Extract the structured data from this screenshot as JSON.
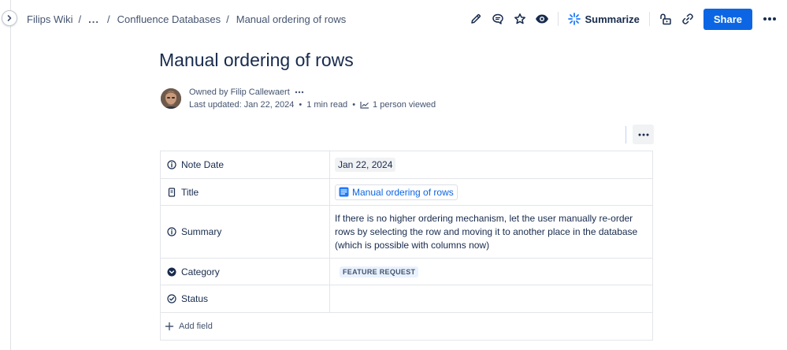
{
  "breadcrumb": {
    "items": [
      "Filips Wiki",
      "...",
      "Confluence Databases",
      "Manual ordering of rows"
    ],
    "separator": "/"
  },
  "actions": {
    "summarize_label": "Summarize",
    "share_label": "Share",
    "icons": [
      "pencil-icon",
      "comment-icon",
      "star-icon",
      "eye-icon",
      "sparkle-icon",
      "unlock-icon",
      "link-icon",
      "more-icon"
    ]
  },
  "page": {
    "title": "Manual ordering of rows",
    "owner": "Owned by Filip Callewaert",
    "last_updated": "Last updated: Jan 22, 2024",
    "dot": "•",
    "read_time": "1 min read",
    "views": "1 person viewed"
  },
  "properties": {
    "rows": [
      {
        "key": "Note Date",
        "icon": "info-icon",
        "value": "Jan 22, 2024",
        "kind": "date"
      },
      {
        "key": "Title",
        "icon": "page-icon",
        "value": "Manual ordering of rows",
        "kind": "page-link"
      },
      {
        "key": "Summary",
        "icon": "info-icon",
        "value": "If there is no higher ordering mechanism, let the user manually re-order rows by selecting the row and moving it to another place in the database (which is possible with columns now)",
        "kind": "text"
      },
      {
        "key": "Category",
        "icon": "chevron-circle-icon",
        "value": "FEATURE REQUEST",
        "kind": "lozenge"
      },
      {
        "key": "Status",
        "icon": "check-circle-icon",
        "value": "",
        "kind": "text"
      }
    ],
    "add_field_label": "Add field"
  },
  "colors": {
    "brand_blue": "#0c66e4",
    "text": "#172b4d",
    "subtle_text": "#44546f",
    "border": "#e3e5e9",
    "lozenge_bg": "#e9f2ff"
  }
}
